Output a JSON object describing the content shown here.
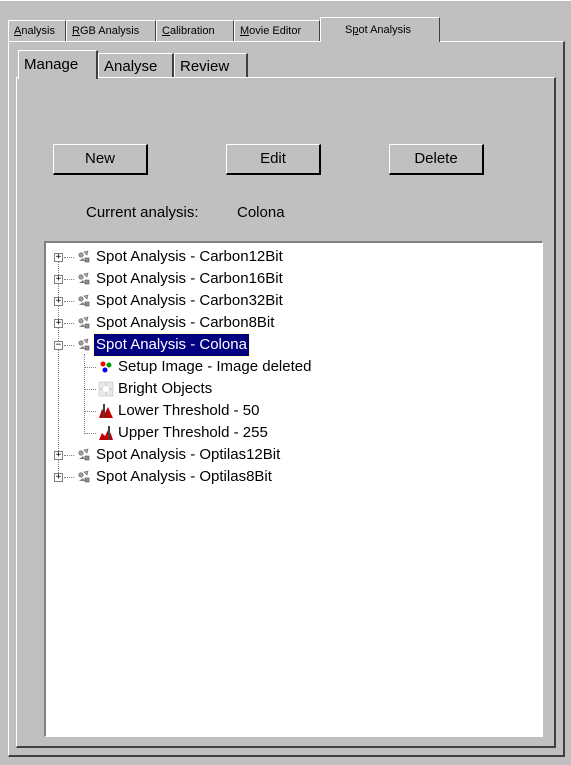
{
  "outer_tabs": [
    {
      "label": "Analysis"
    },
    {
      "label": "RGB Analysis"
    },
    {
      "label": "Calibration"
    },
    {
      "label": "Movie Editor"
    },
    {
      "label": "Spot Analysis",
      "active": true
    }
  ],
  "inner_tabs": [
    {
      "label": "Manage",
      "active": true
    },
    {
      "label": "Analyse"
    },
    {
      "label": "Review"
    }
  ],
  "buttons": {
    "new_label": "New",
    "edit_label": "Edit",
    "delete_label": "Delete"
  },
  "current_analysis": {
    "label": "Current analysis:",
    "value": "Colona"
  },
  "tree": {
    "nodes": [
      {
        "label": "Spot Analysis - Carbon12Bit",
        "level": 0,
        "expanded": false,
        "icon": "analysis-icon"
      },
      {
        "label": "Spot Analysis - Carbon16Bit",
        "level": 0,
        "expanded": false,
        "icon": "analysis-icon"
      },
      {
        "label": "Spot Analysis - Carbon32Bit",
        "level": 0,
        "expanded": false,
        "icon": "analysis-icon"
      },
      {
        "label": "Spot Analysis - Carbon8Bit",
        "level": 0,
        "expanded": false,
        "icon": "analysis-icon"
      },
      {
        "label": "Spot Analysis - Colona",
        "level": 0,
        "expanded": true,
        "selected": true,
        "icon": "analysis-icon"
      },
      {
        "label": "Setup Image - Image deleted",
        "level": 1,
        "icon": "setup-image-icon"
      },
      {
        "label": "Bright Objects",
        "level": 1,
        "icon": "bright-objects-icon"
      },
      {
        "label": "Lower Threshold - 50",
        "level": 1,
        "icon": "lower-threshold-icon"
      },
      {
        "label": "Upper Threshold - 255",
        "level": 1,
        "icon": "upper-threshold-icon"
      },
      {
        "label": "Spot Analysis - Optilas12Bit",
        "level": 0,
        "expanded": false,
        "icon": "analysis-icon"
      },
      {
        "label": "Spot Analysis - Optilas8Bit",
        "level": 0,
        "expanded": false,
        "icon": "analysis-icon"
      }
    ]
  },
  "colors": {
    "face": "#c0c0c0",
    "selection": "#000080"
  }
}
